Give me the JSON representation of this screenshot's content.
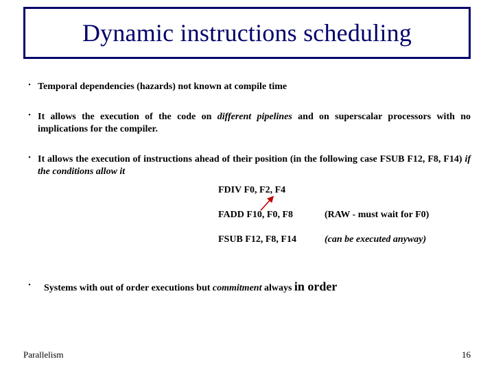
{
  "title": "Dynamic instructions scheduling",
  "bullets": {
    "b1": "Temporal dependencies  (hazards) not known at compile time",
    "b2_a": "It allows the execution of the code on ",
    "b2_b": "different pipelines",
    "b2_c": " and on superscalar processors with no implications for the compiler.",
    "b3_a": "It allows the execution of instructions ahead of their position (in the following case FSUB F12, F8, F14) ",
    "b3_b": "if the conditions allow it"
  },
  "code": {
    "l1": "FDIV  F0, F2, F4",
    "l2": "FADD F10, F0, F8",
    "l2_note": "(RAW - must wait for F0)",
    "l3": "FSUB  F12, F8, F14",
    "l3_note": "(can be executed anyway)"
  },
  "bullet4": {
    "a": "Systems with out of order executions  but ",
    "b": "commitment",
    "c": "  always ",
    "d": "in order"
  },
  "footer": {
    "left": "Parallelism",
    "right": "16"
  }
}
